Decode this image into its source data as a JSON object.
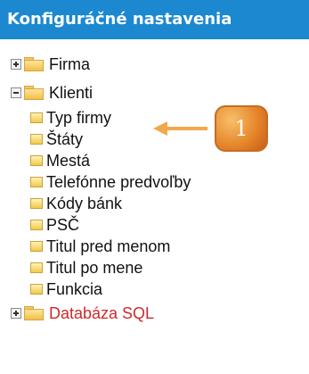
{
  "header": {
    "title": "Konfiguráčné nastavenia"
  },
  "tree": {
    "root_1": {
      "label": "Firma",
      "expanded": false,
      "icon": "folder-icon"
    },
    "root_2": {
      "label": "Klienti",
      "expanded": true,
      "icon": "folder-icon",
      "children": [
        "Typ firmy",
        "Štáty",
        "Mestá",
        "Telefónne predvoľby",
        "Kódy bánk",
        "PSČ",
        "Titul pred menom",
        "Titul po mene",
        "Funkcia"
      ]
    },
    "root_3": {
      "label": "Databáza SQL",
      "expanded": false,
      "icon": "folder-icon",
      "color": "#cc2a2a"
    }
  },
  "callout": {
    "number": "1"
  },
  "colors": {
    "header_bg": "#1c88d0",
    "arrow": "#f2a84c",
    "badge": "#e7872c"
  }
}
